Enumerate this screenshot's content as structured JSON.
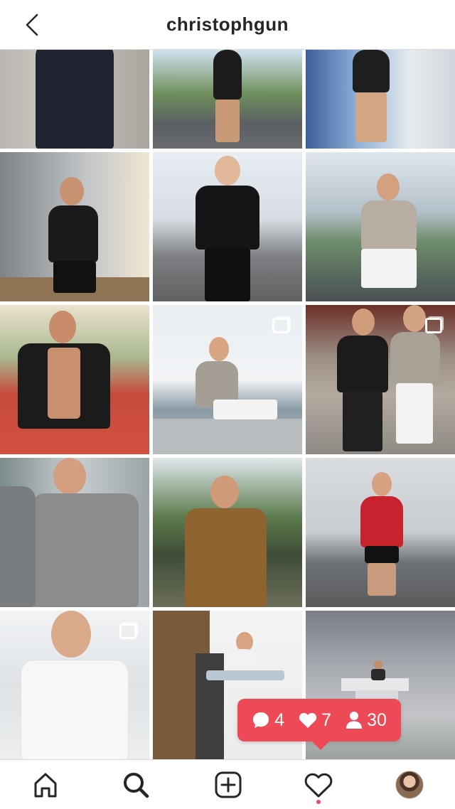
{
  "header": {
    "title": "christophgun",
    "back_icon": "chevron-left-icon"
  },
  "grid": {
    "tiles": [
      {
        "icon": null
      },
      {
        "icon": null
      },
      {
        "icon": null
      },
      {
        "icon": null
      },
      {
        "icon": null
      },
      {
        "icon": null
      },
      {
        "icon": null
      },
      {
        "icon": "multiple-photos-icon"
      },
      {
        "icon": "multiple-photos-icon"
      },
      {
        "icon": null
      },
      {
        "icon": null
      },
      {
        "icon": null
      },
      {
        "icon": "multiple-photos-icon"
      },
      {
        "icon": null
      },
      {
        "icon": null
      }
    ]
  },
  "activity": {
    "comments": "4",
    "likes": "7",
    "followers": "30",
    "color": "#ed4956"
  },
  "tabbar": {
    "tabs": [
      "home-icon",
      "search-icon",
      "add-post-icon",
      "activity-heart-icon",
      "profile-avatar"
    ],
    "active_tab": "search-icon",
    "notification_dot_color": "#ed4956"
  }
}
